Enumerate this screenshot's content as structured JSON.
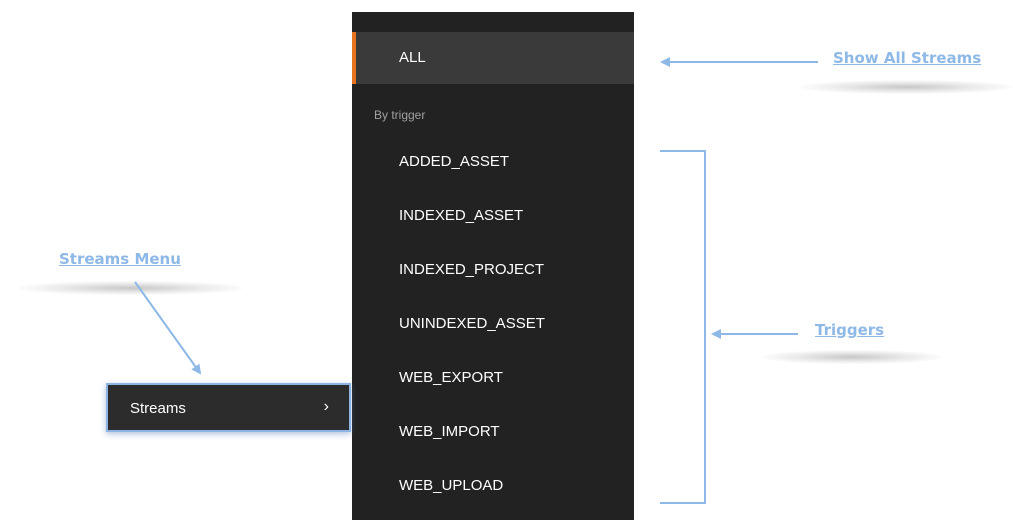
{
  "panel": {
    "items": [
      {
        "label": "ALL",
        "selected": true
      },
      {
        "label": "ADDED_ASSET"
      },
      {
        "label": "INDEXED_ASSET"
      },
      {
        "label": "INDEXED_PROJECT"
      },
      {
        "label": "UNINDEXED_ASSET"
      },
      {
        "label": "WEB_EXPORT"
      },
      {
        "label": "WEB_IMPORT"
      },
      {
        "label": "WEB_UPLOAD"
      }
    ],
    "section_label": "By trigger"
  },
  "menu": {
    "streams_label": "Streams",
    "chevron_icon": "chevron-right-icon",
    "chevron_glyph": "›"
  },
  "annotations": {
    "show_all_streams": "Show All Streams",
    "streams_menu": "Streams Menu",
    "triggers": "Triggers"
  },
  "colors": {
    "panel_bg": "#222222",
    "selected_bg": "#3a3a3a",
    "accent": "#e8731e",
    "annotation": "#8eb8e6"
  }
}
